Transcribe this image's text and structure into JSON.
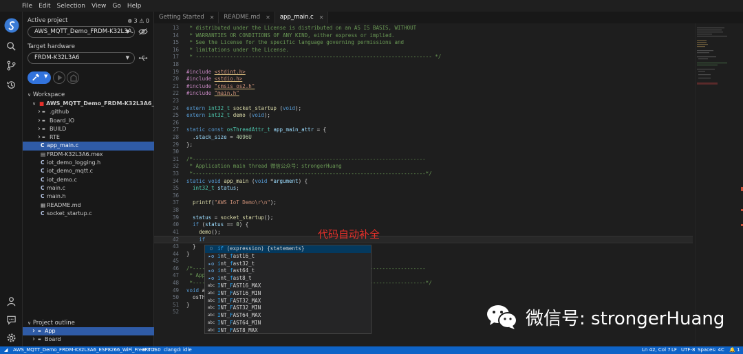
{
  "menu": [
    "File",
    "Edit",
    "Selection",
    "View",
    "Go",
    "Help"
  ],
  "sidebar": {
    "active_project_label": "Active project",
    "active_project_value": "AWS_MQTT_Demo_FRDM-K32L3A...",
    "problem_counts": "⊗ 3 ⚠ 0",
    "target_hardware_label": "Target hardware",
    "target_hardware_value": "FRDM-K32L3A6",
    "workspace_label": "Workspace",
    "workspace_root": "AWS_MQTT_Demo_FRDM-K32L3A6_...",
    "workspace_items": [
      {
        "label": ".github",
        "kind": "folder"
      },
      {
        "label": "Board_IO",
        "kind": "folder"
      },
      {
        "label": "BUILD",
        "kind": "folder"
      },
      {
        "label": "RTE",
        "kind": "folder"
      },
      {
        "label": "app_main.c",
        "kind": "c-file",
        "selected": true
      },
      {
        "label": "FRDM-K32L3A6.mex",
        "kind": "file"
      },
      {
        "label": "iot_demo_logging.h",
        "kind": "c-file"
      },
      {
        "label": "iot_demo_mqtt.c",
        "kind": "c-file"
      },
      {
        "label": "iot_demo.c",
        "kind": "c-file"
      },
      {
        "label": "main.c",
        "kind": "c-file"
      },
      {
        "label": "main.h",
        "kind": "c-file"
      },
      {
        "label": "README.md",
        "kind": "md-file"
      },
      {
        "label": "socket_startup.c",
        "kind": "c-file"
      }
    ],
    "outline_label": "Project outline",
    "outline_items": [
      {
        "label": "App",
        "selected": true
      },
      {
        "label": "Board"
      }
    ]
  },
  "tabs": [
    {
      "label": "Getting Started"
    },
    {
      "label": "README.md"
    },
    {
      "label": "app_main.c",
      "active": true
    }
  ],
  "code_lines": [
    {
      "n": "13",
      "t": " * distributed under the License is distributed on an AS IS BASIS, WITHOUT"
    },
    {
      "n": "14",
      "t": " * WARRANTIES OR CONDITIONS OF ANY KIND, either express or implied."
    },
    {
      "n": "15",
      "t": " * See the License for the specific language governing permissions and"
    },
    {
      "n": "16",
      "t": " * limitations under the License."
    },
    {
      "n": "17",
      "t": " * ---------------------------------------------------------------------------- */"
    },
    {
      "n": "18",
      "t": ""
    },
    {
      "n": "19",
      "t": "#include <stdint.h>"
    },
    {
      "n": "20",
      "t": "#include <stdio.h>"
    },
    {
      "n": "21",
      "t": "#include \"cmsis_os2.h\""
    },
    {
      "n": "22",
      "t": "#include \"main.h\""
    },
    {
      "n": "23",
      "t": ""
    },
    {
      "n": "24",
      "t": "extern int32_t socket_startup (void);"
    },
    {
      "n": "25",
      "t": "extern int32_t demo (void);"
    },
    {
      "n": "26",
      "t": ""
    },
    {
      "n": "27",
      "t": "static const osThreadAttr_t app_main_attr = {"
    },
    {
      "n": "28",
      "t": "  .stack_size = 4096U"
    },
    {
      "n": "29",
      "t": "};"
    },
    {
      "n": "30",
      "t": ""
    },
    {
      "n": "31",
      "t": "/*---------------------------------------------------------------------------"
    },
    {
      "n": "32",
      "t": " * Application main thread 微信公众号：strongerHuang"
    },
    {
      "n": "33",
      "t": " *---------------------------------------------------------------------------*/"
    },
    {
      "n": "34",
      "t": "static void app_main (void *argument) {"
    },
    {
      "n": "35",
      "t": "  int32_t status;"
    },
    {
      "n": "36",
      "t": ""
    },
    {
      "n": "37",
      "t": "  printf(\"AWS IoT Demo\\r\\n\");"
    },
    {
      "n": "38",
      "t": ""
    },
    {
      "n": "39",
      "t": "  status = socket_startup();"
    },
    {
      "n": "40",
      "t": "  if (status == 0) {"
    },
    {
      "n": "41",
      "t": "    demo();"
    },
    {
      "n": "42",
      "t": "    if"
    },
    {
      "n": "43",
      "t": "  }"
    },
    {
      "n": "44",
      "t": "}"
    },
    {
      "n": "45",
      "t": ""
    },
    {
      "n": "46",
      "t": "/*---------------------------------------------------------------------------"
    },
    {
      "n": "47",
      "t": " * App"
    },
    {
      "n": "48",
      "t": " *---------------------------------------------------------------------------*/"
    },
    {
      "n": "49",
      "t": "void a"
    },
    {
      "n": "50",
      "t": "  osTh"
    },
    {
      "n": "51",
      "t": "}"
    },
    {
      "n": "52",
      "t": ""
    }
  ],
  "suggestions": [
    {
      "kind": "snippet",
      "match": "if",
      "rest": " (expression) {statements}"
    },
    {
      "kind": "macro",
      "match": "i",
      "rest": "nt_",
      "match2": "f",
      "rest2": "ast16_t"
    },
    {
      "kind": "macro",
      "match": "i",
      "rest": "nt_",
      "match2": "f",
      "rest2": "ast32_t"
    },
    {
      "kind": "macro",
      "match": "i",
      "rest": "nt_",
      "match2": "f",
      "rest2": "ast64_t"
    },
    {
      "kind": "macro",
      "match": "i",
      "rest": "nt_",
      "match2": "f",
      "rest2": "ast8_t"
    },
    {
      "kind": "text",
      "match": "I",
      "rest": "NT_",
      "match2": "F",
      "rest2": "AST16_MAX"
    },
    {
      "kind": "text",
      "match": "I",
      "rest": "NT_",
      "match2": "F",
      "rest2": "AST16_MIN"
    },
    {
      "kind": "text",
      "match": "I",
      "rest": "NT_",
      "match2": "F",
      "rest2": "AST32_MAX"
    },
    {
      "kind": "text",
      "match": "I",
      "rest": "NT_",
      "match2": "F",
      "rest2": "AST32_MIN"
    },
    {
      "kind": "text",
      "match": "I",
      "rest": "NT_",
      "match2": "F",
      "rest2": "AST64_MAX"
    },
    {
      "kind": "text",
      "match": "I",
      "rest": "NT_",
      "match2": "F",
      "rest2": "AST64_MIN"
    },
    {
      "kind": "text",
      "match": "I",
      "rest": "NT_",
      "match2": "F",
      "rest2": "AST8_MAX"
    }
  ],
  "annotation": "代码自动补全",
  "watermark": "微信号: strongerHuang",
  "status": {
    "project": "AWS_MQTT_Demo_FRDM-K32L3A6_ESP8266_WiFi_FreeRTOS",
    "problems": "⊗ 3 ⚠ 0",
    "clangd": "clangd: idle",
    "position": "Ln 42, Col 7",
    "eol": "LF",
    "encoding": "UTF-8",
    "indent": "Spaces: 4",
    "language": "C",
    "notifications": "🔔 1"
  },
  "colors": {
    "statusbar": "#0e63c7",
    "selection": "#2f5ba6",
    "annotation": "#e8302a"
  }
}
